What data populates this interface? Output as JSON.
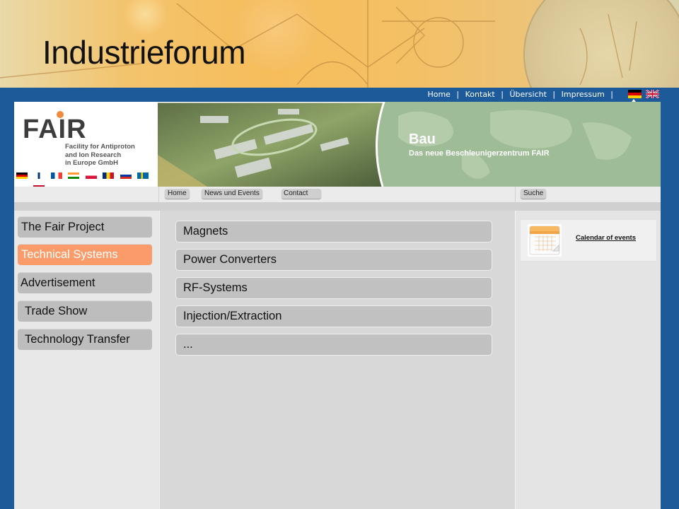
{
  "slide_title": "Industrieforum",
  "top_links": {
    "home": "Home",
    "kontakt": "Kontakt",
    "uebersicht": "Übersicht",
    "impressum": "Impressum",
    "separator": "|"
  },
  "logo": {
    "name": "FAIR",
    "subtitle_line1": "Facility for Antiproton",
    "subtitle_line2": "and Ion Research",
    "subtitle_line3": "in Europe GmbH"
  },
  "hero": {
    "title": "Bau",
    "subtitle": "Das neue Beschleunigerzentrum FAIR"
  },
  "subnav": {
    "home": "Home",
    "news": "News und Events",
    "contact": "Contact",
    "search": "Suche"
  },
  "sidebar": {
    "items": [
      {
        "label": "The Fair Project",
        "active": false
      },
      {
        "label": "Technical Systems",
        "active": true
      },
      {
        "label": "Advertisement",
        "active": false
      },
      {
        "label": "Trade Show",
        "active": false
      },
      {
        "label": "Technology Transfer",
        "active": false
      }
    ]
  },
  "main_menu": {
    "items": [
      {
        "label": "Magnets"
      },
      {
        "label": "Power Converters"
      },
      {
        "label": "RF-Systems"
      },
      {
        "label": "Injection/Extraction"
      },
      {
        "label": "..."
      }
    ]
  },
  "right_panel": {
    "calendar_link": "Calendar of events",
    "calendar_icon": "calendar-icon"
  },
  "colors": {
    "frame_blue": "#1d5a9a",
    "active_orange": "#fb9b6a",
    "button_gray": "#bdbdbd"
  }
}
